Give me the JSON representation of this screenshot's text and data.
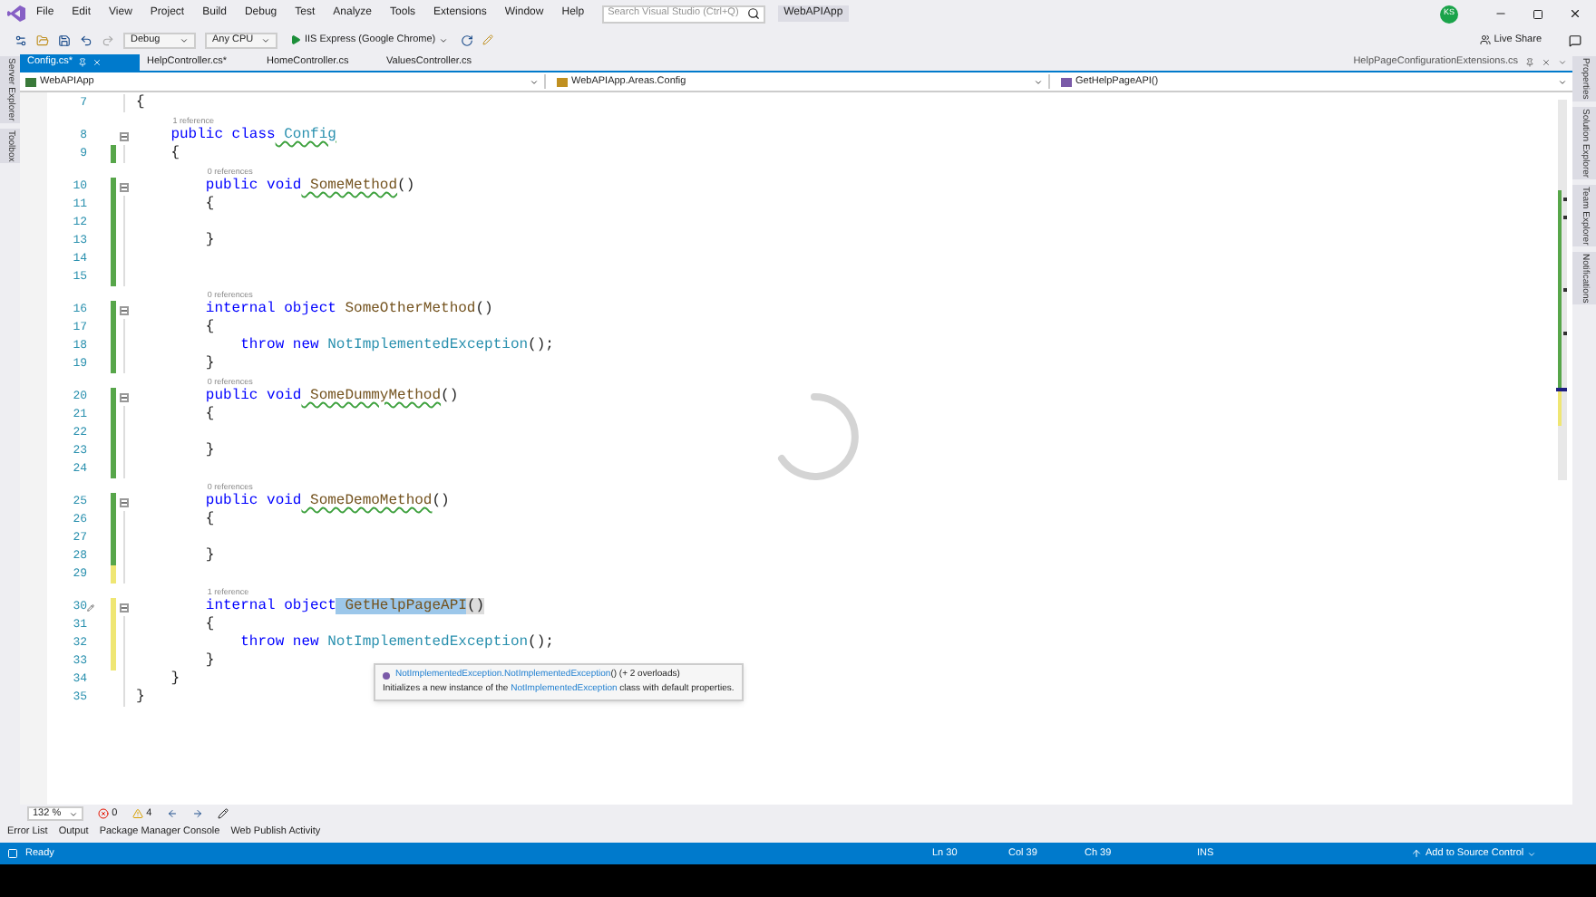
{
  "menu": {
    "items": [
      "File",
      "Edit",
      "View",
      "Project",
      "Build",
      "Debug",
      "Test",
      "Analyze",
      "Tools",
      "Extensions",
      "Window",
      "Help"
    ],
    "search": {
      "placeholder": "Search Visual Studio (Ctrl+Q)"
    },
    "solution": "WebAPIApp",
    "avatar": "KS"
  },
  "toolbar": {
    "items": [
      {
        "kind": "dropdown",
        "label": "Debug"
      },
      {
        "kind": "dropdown",
        "label": "Any CPU"
      },
      {
        "kind": "run",
        "label": "IIS Express (Google Chrome)"
      }
    ],
    "live_share": "Live Share"
  },
  "left_panels": [
    "Server Explorer",
    "Toolbox"
  ],
  "right_panels": [
    "Properties",
    "Solution Explorer",
    "Team Explorer",
    "Notifications"
  ],
  "tabs": [
    {
      "label": "Config.cs*",
      "selected": true
    },
    {
      "label": "HelpController.cs*",
      "selected": false
    },
    {
      "label": "HomeController.cs",
      "selected": false
    },
    {
      "label": "ValuesController.cs",
      "selected": false
    }
  ],
  "preview_tab": "HelpPageConfigurationExtensions.cs",
  "navigation": {
    "project": "WebAPIApp",
    "type": "WebAPIApp.Areas.Config",
    "member": "GetHelpPageAPI()"
  },
  "editor": {
    "lines": [
      {
        "number": "7",
        "modified": false,
        "code": [
          {
            "text": "{",
            "kind": "plain"
          }
        ]
      },
      {
        "number": "8",
        "modified": false,
        "fold": true,
        "lens": "1 reference",
        "code": [
          {
            "text": "    public class",
            "kind": "keyword"
          },
          {
            "text": " Config",
            "kind": "type",
            "squiggle": true
          }
        ]
      },
      {
        "number": "9",
        "modified": true,
        "saved": true,
        "code": [
          {
            "text": "    {",
            "kind": "plain"
          }
        ]
      },
      {
        "number": "10",
        "modified": true,
        "saved": true,
        "fold": true,
        "lens": "0 references",
        "code": [
          {
            "text": "        public void",
            "kind": "keyword"
          },
          {
            "text": " SomeMethod",
            "kind": "method",
            "squiggle": true
          },
          {
            "text": "()",
            "kind": "plain"
          }
        ]
      },
      {
        "number": "11",
        "modified": true,
        "saved": true,
        "code": [
          {
            "text": "        {",
            "kind": "plain"
          }
        ]
      },
      {
        "number": "12",
        "modified": true,
        "saved": true
      },
      {
        "number": "13",
        "modified": true,
        "saved": true,
        "code": [
          {
            "text": "        }",
            "kind": "plain"
          }
        ]
      },
      {
        "number": "14",
        "modified": true,
        "saved": true
      },
      {
        "number": "15",
        "modified": true,
        "saved": true
      },
      {
        "number": "16",
        "modified": true,
        "saved": true,
        "fold": true,
        "lens": "0 references",
        "code": [
          {
            "text": "        internal object",
            "kind": "keyword"
          },
          {
            "text": " SomeOtherMethod",
            "kind": "method"
          },
          {
            "text": "()",
            "kind": "plain"
          }
        ]
      },
      {
        "number": "17",
        "modified": true,
        "saved": true,
        "code": [
          {
            "text": "        {",
            "kind": "plain"
          }
        ]
      },
      {
        "number": "18",
        "modified": true,
        "saved": true,
        "code": [
          {
            "text": "            throw new",
            "kind": "keyword"
          },
          {
            "text": " NotImplementedException",
            "kind": "type"
          },
          {
            "text": "();",
            "kind": "plain"
          }
        ]
      },
      {
        "number": "19",
        "modified": true,
        "saved": true,
        "code": [
          {
            "text": "        }",
            "kind": "plain"
          }
        ]
      },
      {
        "number": "20",
        "modified": true,
        "saved": true,
        "fold": true,
        "lens": "0 references",
        "code": [
          {
            "text": "        public void",
            "kind": "keyword"
          },
          {
            "text": " SomeDummyMethod",
            "kind": "method",
            "squiggle": true
          },
          {
            "text": "()",
            "kind": "plain"
          }
        ]
      },
      {
        "number": "21",
        "modified": true,
        "saved": true,
        "code": [
          {
            "text": "        {",
            "kind": "plain"
          }
        ]
      },
      {
        "number": "22",
        "modified": true,
        "saved": true
      },
      {
        "number": "23",
        "modified": true,
        "saved": true,
        "code": [
          {
            "text": "        }",
            "kind": "plain"
          }
        ]
      },
      {
        "number": "24",
        "modified": true,
        "saved": true
      },
      {
        "number": "25",
        "modified": true,
        "saved": true,
        "fold": true,
        "lens": "0 references",
        "code": [
          {
            "text": "        public void",
            "kind": "keyword"
          },
          {
            "text": " SomeDemoMethod",
            "kind": "method",
            "squiggle": true
          },
          {
            "text": "()",
            "kind": "plain"
          }
        ]
      },
      {
        "number": "26",
        "modified": true,
        "saved": true,
        "code": [
          {
            "text": "        {",
            "kind": "plain"
          }
        ]
      },
      {
        "number": "27",
        "modified": true,
        "saved": true
      },
      {
        "number": "28",
        "modified": true,
        "saved": true,
        "code": [
          {
            "text": "        }",
            "kind": "plain"
          }
        ]
      },
      {
        "number": "29",
        "modified": true,
        "saved": false
      },
      {
        "number": "30",
        "modified": true,
        "saved": false,
        "fold": true,
        "quick_action": true,
        "lens": "1 reference",
        "code": [
          {
            "text": "        internal object",
            "kind": "keyword"
          },
          {
            "text": " GetHelpPageAPI",
            "kind": "method",
            "selected": true
          },
          {
            "text": "()",
            "kind": "plain",
            "brace_match": true
          }
        ]
      },
      {
        "number": "31",
        "modified": true,
        "saved": false,
        "code": [
          {
            "text": "        {",
            "kind": "plain"
          }
        ]
      },
      {
        "number": "32",
        "modified": true,
        "saved": false,
        "code": [
          {
            "text": "            throw new",
            "kind": "keyword"
          },
          {
            "text": " NotImplementedException",
            "kind": "type"
          },
          {
            "text": "();",
            "kind": "plain"
          }
        ]
      },
      {
        "number": "33",
        "modified": true,
        "saved": false,
        "code": [
          {
            "text": "        }",
            "kind": "plain"
          }
        ]
      },
      {
        "number": "34",
        "modified": false,
        "code": [
          {
            "text": "    }",
            "kind": "plain"
          }
        ]
      },
      {
        "number": "35",
        "modified": false,
        "code": [
          {
            "text": "}",
            "kind": "plain"
          }
        ]
      }
    ],
    "tooltip": {
      "signature": [
        {
          "text": "NotImplementedException.NotImplementedException",
          "kind": "link"
        },
        {
          "text": "() (+ 2 overloads)",
          "kind": "plain"
        }
      ],
      "description": [
        {
          "text": "Initializes a new instance of the ",
          "kind": "plain"
        },
        {
          "text": "NotImplementedException",
          "kind": "link"
        },
        {
          "text": " class with default properties.",
          "kind": "plain"
        }
      ]
    }
  },
  "editor_footer": {
    "zoom": "132 %",
    "errors": "0",
    "warnings": "4"
  },
  "tool_tabs": [
    "Error List",
    "Output",
    "Package Manager Console",
    "Web Publish Activity"
  ],
  "status_bar": {
    "message": "Ready",
    "line": "Ln 30",
    "column": "Col 39",
    "char": "Ch 39",
    "mode": "INS",
    "source_control": "Add to Source Control"
  }
}
